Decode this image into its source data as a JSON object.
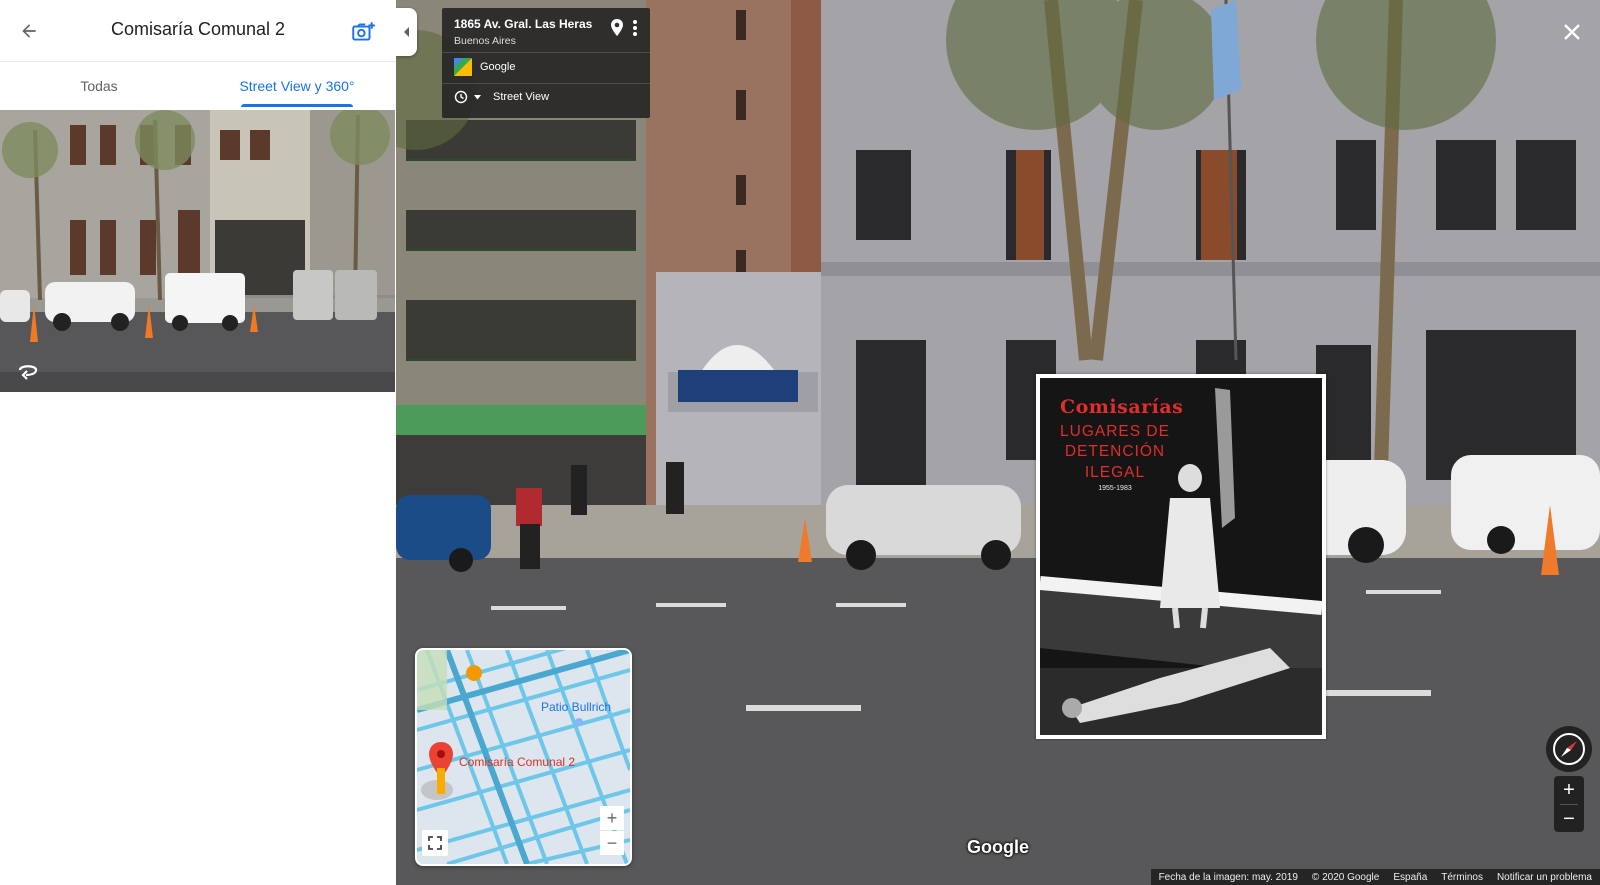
{
  "panel": {
    "title": "Comisaría Comunal 2",
    "tabs": [
      {
        "label": "Todas"
      },
      {
        "label": "Street View y 360°"
      }
    ],
    "active_tab": 1
  },
  "street_view": {
    "address": "1865 Av. Gral. Las Heras",
    "city": "Buenos Aires",
    "provider": "Google",
    "history_label": "Street View",
    "overlay": {
      "title": "Comisarías",
      "lines": [
        "LUGARES DE",
        "DETENCIÓN",
        "ILEGAL"
      ],
      "years": "1955-1983"
    },
    "minimap": {
      "poi_label": "Patio Bullrich",
      "place_label": "Comisaría Comunal 2",
      "zoom_in": "+",
      "zoom_out": "−"
    },
    "logo": "Google",
    "zoom_in": "+",
    "zoom_out": "−",
    "footer": {
      "date": "Fecha de la imagen: may. 2019",
      "copyright": "© 2020 Google",
      "region": "España",
      "terms": "Términos",
      "report": "Notificar un problema"
    }
  },
  "colors": {
    "accent": "#1a73e8",
    "pin_red": "#ea4335",
    "overlay_red": "#e22d2d",
    "map_street": "#6ec6e8"
  },
  "icons": {
    "back": "arrow-left-icon",
    "add_photo": "add-photo-icon",
    "rotate": "rotate-360-icon",
    "pin": "location-pin-icon",
    "more": "more-vert-icon",
    "history": "clock-icon",
    "close": "close-icon",
    "compass": "compass-icon",
    "fullscreen": "fullscreen-icon"
  }
}
